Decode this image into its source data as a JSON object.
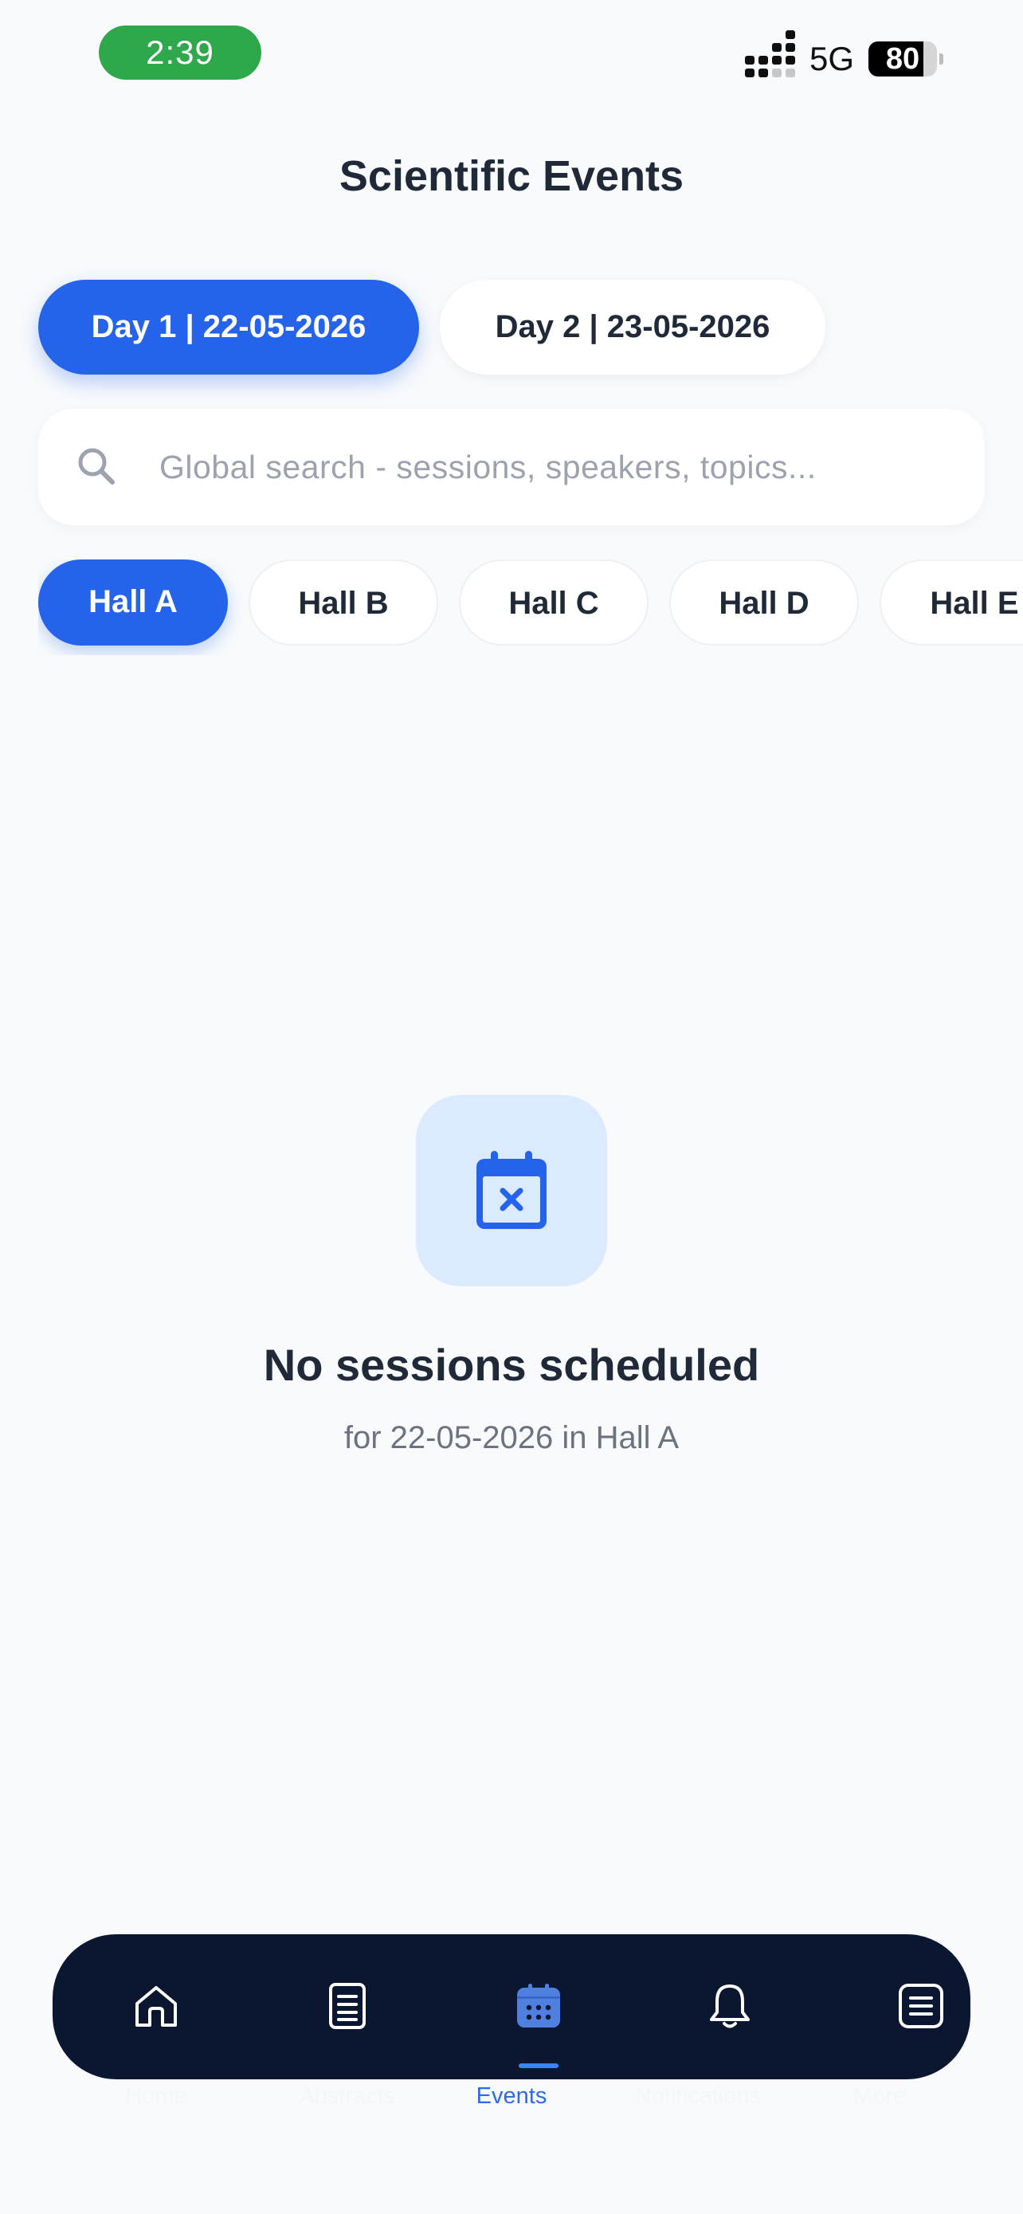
{
  "status_bar": {
    "time": "2:39",
    "network": "5G",
    "battery": "80",
    "battery_level": 0.8
  },
  "header": {
    "title": "Scientific Events"
  },
  "day_tabs": [
    {
      "label": "Day 1 | 22-05-2026",
      "selected": true
    },
    {
      "label": "Day 2 | 23-05-2026",
      "selected": false
    }
  ],
  "search": {
    "placeholder": "Global search - sessions, speakers, topics...",
    "value": "",
    "icon": "search-icon"
  },
  "halls": [
    {
      "label": "Hall A",
      "selected": true
    },
    {
      "label": "Hall B",
      "selected": false
    },
    {
      "label": "Hall C",
      "selected": false
    },
    {
      "label": "Hall D",
      "selected": false
    },
    {
      "label": "Hall E",
      "selected": false
    }
  ],
  "empty_state": {
    "icon": "calendar-x-icon",
    "title": "No sessions scheduled",
    "subtitle": "for 22-05-2026 in Hall A"
  },
  "bottom_nav": [
    {
      "label": "Home",
      "icon": "home-icon",
      "active": false
    },
    {
      "label": "Abstracts",
      "icon": "document-icon",
      "active": false
    },
    {
      "label": "Events",
      "icon": "calendar-icon",
      "active": true
    },
    {
      "label": "Notifications",
      "icon": "bell-icon",
      "active": false
    },
    {
      "label": "More",
      "icon": "menu-list-icon",
      "active": false
    }
  ],
  "colors": {
    "primary": "#2563eb",
    "background": "#f8fafc",
    "nav_background": "#0b1631",
    "time_pill": "#2ea84a",
    "empty_icon_bg": "#dbeafe"
  }
}
